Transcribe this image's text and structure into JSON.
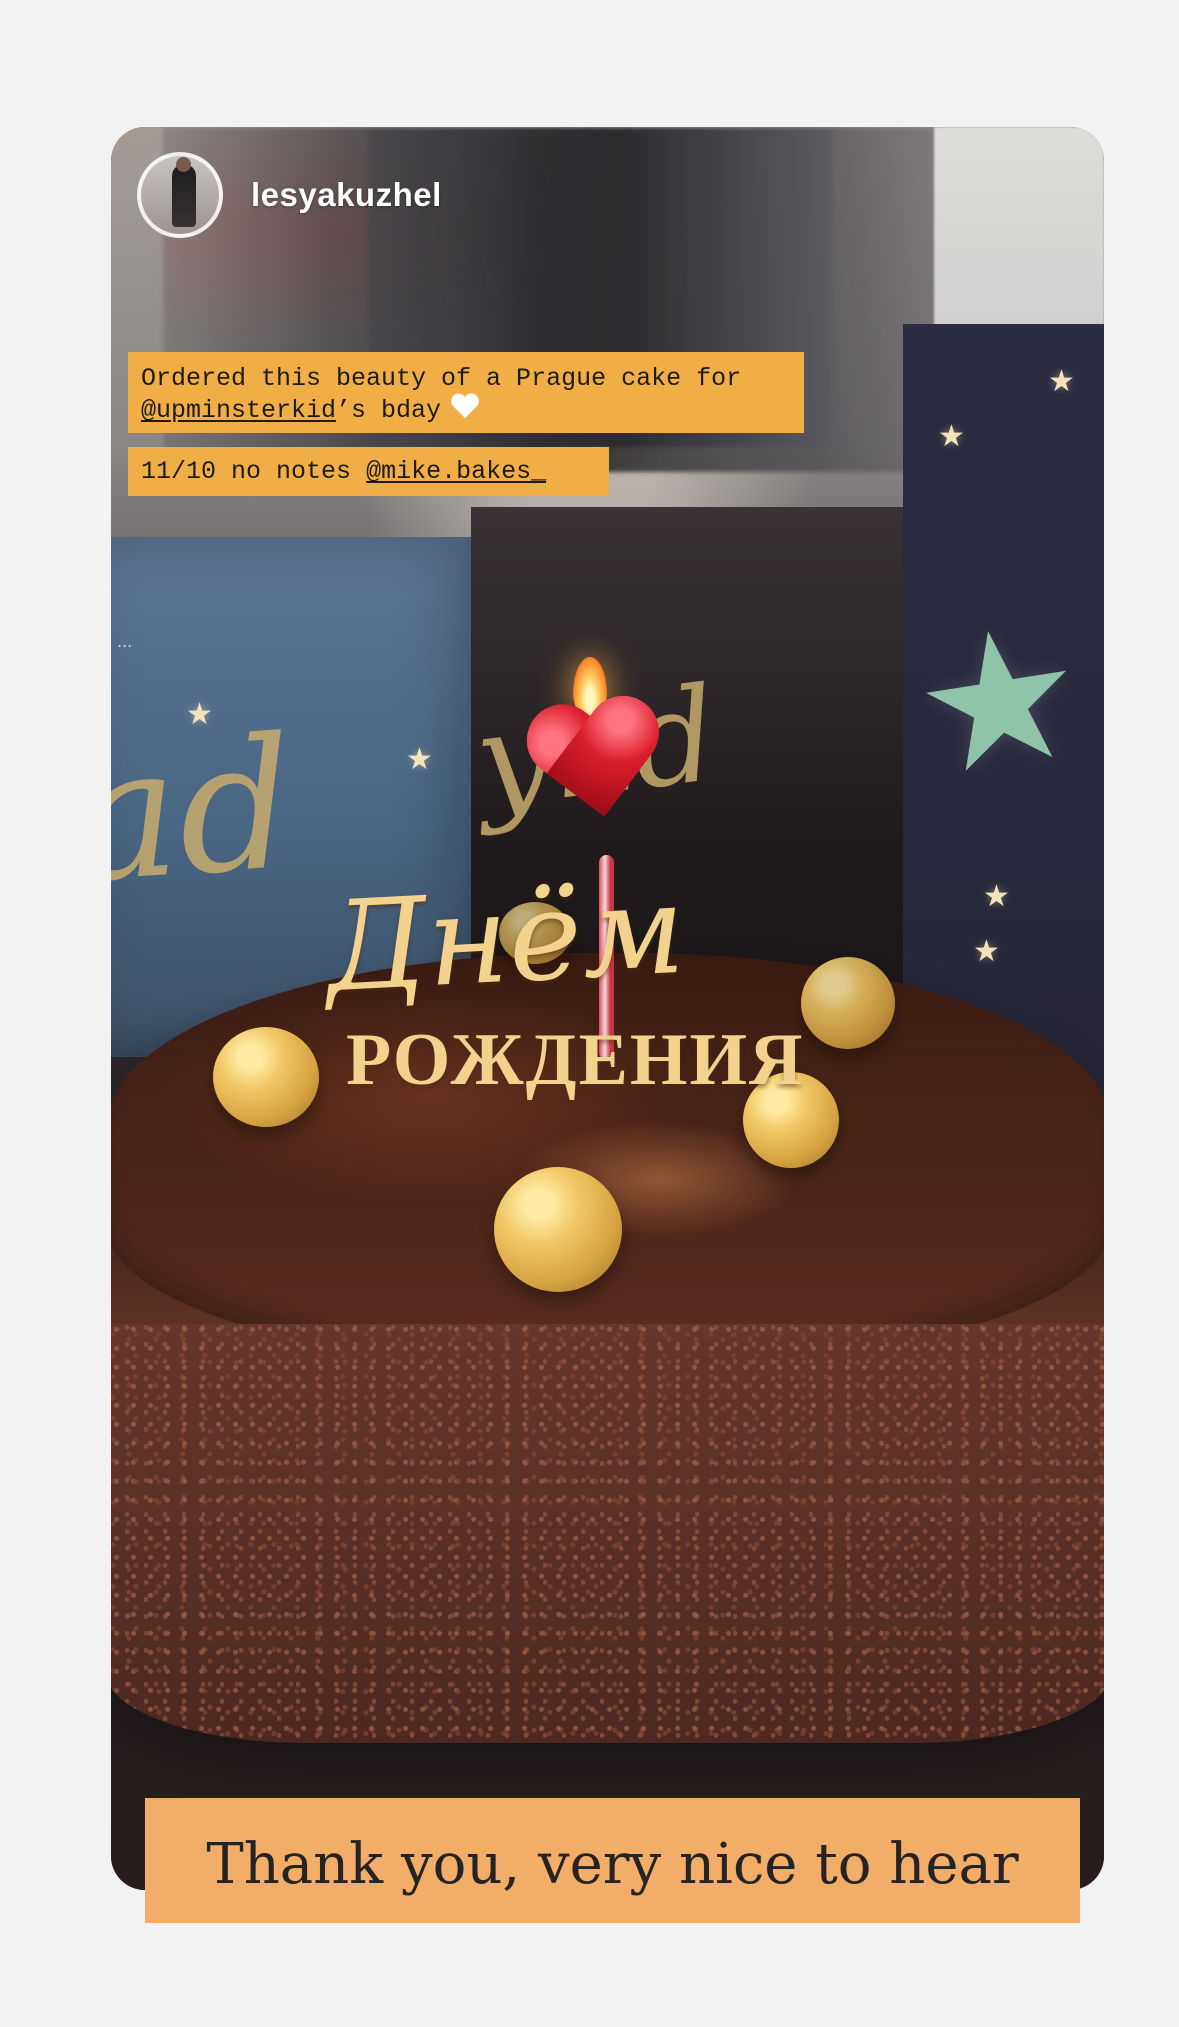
{
  "story": {
    "username": "lesyakuzhel",
    "caption_line1_text": "Ordered this beauty of a Prague cake for",
    "caption_line1_mention": "@upminsterkid",
    "caption_line1_suffix": "’s bday",
    "caption_line2_text": "11/10 no notes",
    "caption_line2_mention": "@mike.bakes_",
    "topper_script": "Днём",
    "topper_caps": "РОЖДЕНИЯ",
    "reply": "Thank you, very nice to hear"
  },
  "colors": {
    "caption_bg": "#f1ae46",
    "reply_bg": "#f2ad69",
    "page_bg": "#f2f2f2"
  },
  "icons": {
    "avatar": "profile-photo",
    "caption_emoji": "white-heart-icon"
  }
}
